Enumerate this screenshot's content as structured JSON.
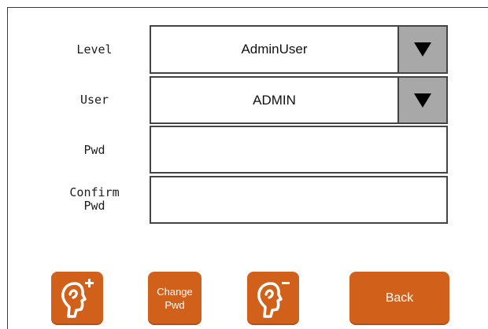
{
  "form": {
    "level_label": "Level",
    "level_value": "AdminUser",
    "user_label": "User",
    "user_value": "ADMIN",
    "pwd_label": "Pwd",
    "pwd_value": "",
    "confirm_label_line1": "Confirm",
    "confirm_label_line2": "Pwd",
    "confirm_value": ""
  },
  "buttons": {
    "add_user_icon": "add-user-icon",
    "change_pwd_line1": "Change",
    "change_pwd_line2": "Pwd",
    "remove_user_icon": "remove-user-icon",
    "back_label": "Back"
  },
  "colors": {
    "accent": "#d1611a",
    "dropdown_bg": "#a8a8a8"
  }
}
